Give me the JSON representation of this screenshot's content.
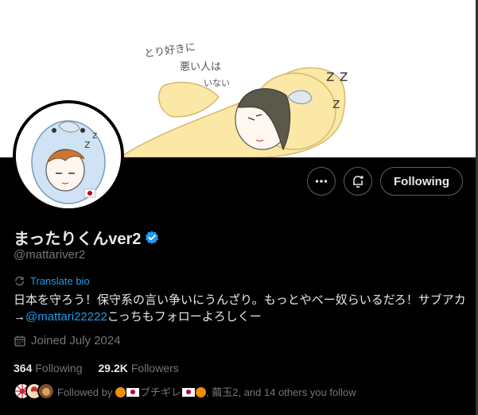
{
  "profile": {
    "display_name": "まったりくんver2",
    "verified": true,
    "handle": "@mattariver2",
    "translate_label": "Translate bio",
    "bio_text_1": "日本を守ろう！保守系の言い争いにうんざり。もっとやべー奴らいるだろ！サブアカ→",
    "bio_link": "@mattari22222",
    "bio_text_2": "こっちもフォローよろしくー",
    "joined": "Joined July 2024",
    "following_count": "364",
    "following_label": "Following",
    "followers_count": "29.2K",
    "followers_label": "Followers"
  },
  "banner": {
    "caption_line1": "とり好きに",
    "caption_line2": "悪い人は",
    "caption_line3": "いない"
  },
  "actions": {
    "more_icon": "more-horizontal-icon",
    "notify_icon": "bell-plus-icon",
    "following_label": "Following"
  },
  "followed_by": {
    "prefix": "Followed by",
    "user1_name": "ブチギレ",
    "rest": ", 繭玉2, and 14 others you follow"
  },
  "colors": {
    "accent": "#1d9bf0",
    "muted": "#71767b",
    "text": "#e7e9ea",
    "verified": "#1d9bf0"
  }
}
